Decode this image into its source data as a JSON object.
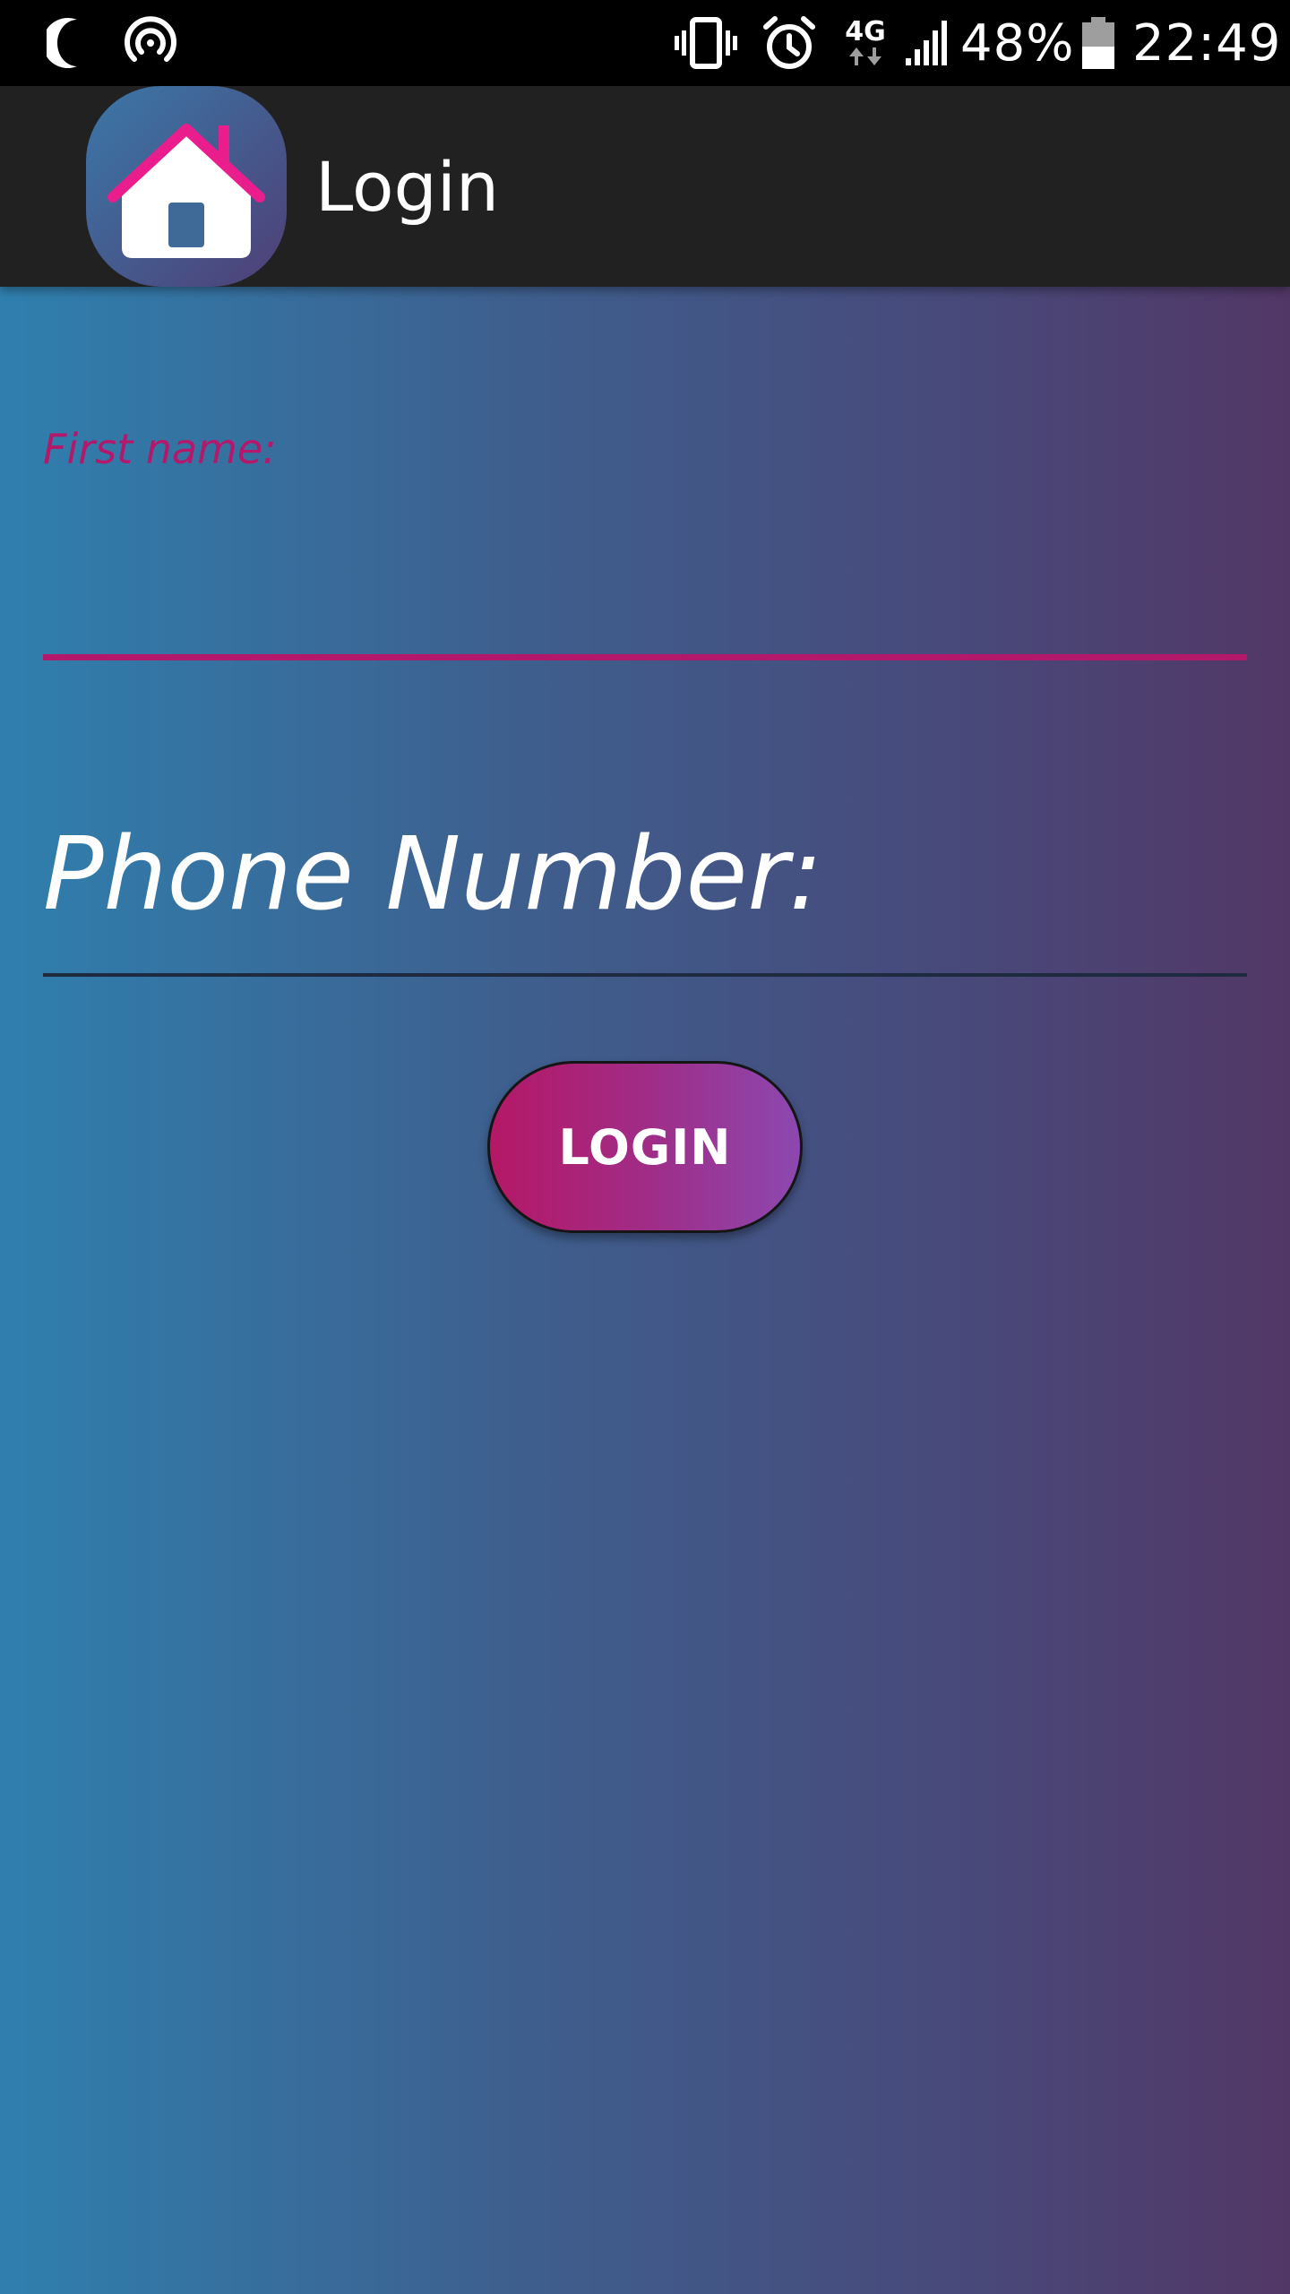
{
  "status_bar": {
    "icons": [
      "moon-icon",
      "hotspot-icon",
      "vibrate-icon",
      "alarm-icon",
      "network-4g-icon",
      "signal-icon",
      "battery-icon"
    ],
    "network_type": "4G",
    "battery_percent": "48%",
    "battery_level": 0.48,
    "time": "22:49"
  },
  "app_bar": {
    "logo": "home-icon",
    "title": "Login"
  },
  "form": {
    "first_name_label": "First name:",
    "first_name_value": "",
    "phone_placeholder": "Phone Number:",
    "login_button_label": "LOGIN"
  },
  "colors": {
    "accent": "#b3186b",
    "app_bar": "#212121",
    "status_bar": "#000000",
    "background_start": "#2f7fae",
    "background_end": "#523766",
    "button_start": "#b51866",
    "button_end": "#8c48b0"
  }
}
